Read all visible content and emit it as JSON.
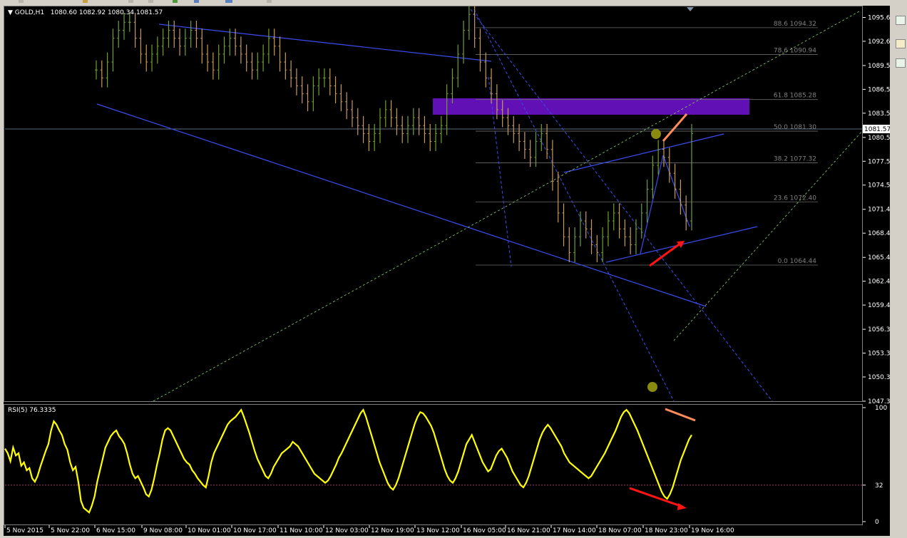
{
  "header": {
    "symbol": "GOLD,H1",
    "ohlc": "1080.60 1082.92 1080.34 1081.57",
    "rsi_label": "RSI(5) 76.3335"
  },
  "colors": {
    "background": "#000000",
    "bull_bar": "#6fa030",
    "bear_bar": "#c89a5a",
    "trendline": "#3b4cf0",
    "fib": "#6a6a6a",
    "zone": "#6a12c8",
    "rsi_line": "#ffff00",
    "arrow_red": "#ff1414",
    "arrow_orange": "#ff8c5a",
    "marker": "#8a8a10"
  },
  "current_price": "1081.57",
  "chart_data": [
    {
      "type": "line",
      "panel": "price",
      "title": "GOLD,H1",
      "ylim": [
        1047.31,
        1097.0
      ],
      "y_ticks": [
        "1095.61",
        "1092.61",
        "1089.56",
        "1086.56",
        "1083.56",
        "1080.51",
        "1077.51",
        "1074.51",
        "1071.46",
        "1068.46",
        "1065.41",
        "1062.41",
        "1059.41",
        "1056.36",
        "1053.36",
        "1050.36",
        "1047.31"
      ],
      "x_ticks": [
        "5 Nov 2015",
        "5 Nov 22:00",
        "6 Nov 15:00",
        "9 Nov 08:00",
        "10 Nov 01:00",
        "10 Nov 17:00",
        "11 Nov 10:00",
        "12 Nov 03:00",
        "12 Nov 19:00",
        "13 Nov 12:00",
        "16 Nov 05:00",
        "16 Nov 21:00",
        "17 Nov 14:00",
        "18 Nov 07:00",
        "18 Nov 23:00",
        "19 Nov 16:00"
      ],
      "fibonacci_levels": [
        {
          "ratio": "88.6",
          "price": "1094.32"
        },
        {
          "ratio": "78.6",
          "price": "1090.94"
        },
        {
          "ratio": "61.8",
          "price": "1085.28"
        },
        {
          "ratio": "50.0",
          "price": "1081.30"
        },
        {
          "ratio": "38.2",
          "price": "1077.32"
        },
        {
          "ratio": "23.6",
          "price": "1072.40"
        },
        {
          "ratio": "0.0",
          "price": "1064.44"
        }
      ],
      "close_series": [
        1089,
        1088,
        1090,
        1093,
        1094,
        1095,
        1095,
        1093,
        1091,
        1090,
        1091,
        1092,
        1093,
        1094,
        1093,
        1092,
        1093,
        1094,
        1093,
        1091,
        1090,
        1089,
        1091,
        1092,
        1093,
        1092,
        1091,
        1090,
        1089,
        1090,
        1091,
        1093,
        1092,
        1090,
        1089,
        1088,
        1087,
        1086,
        1085,
        1087,
        1088,
        1088,
        1087,
        1086,
        1085,
        1084,
        1083,
        1082,
        1081,
        1080,
        1081,
        1083,
        1084,
        1083,
        1082,
        1081,
        1082,
        1083,
        1082,
        1081,
        1080,
        1081,
        1082,
        1086,
        1088,
        1091,
        1094,
        1096,
        1093,
        1090,
        1088,
        1086,
        1084,
        1083,
        1082,
        1081,
        1080,
        1079,
        1078,
        1080,
        1081,
        1079,
        1075,
        1071,
        1068,
        1066,
        1068,
        1070,
        1069,
        1067,
        1066,
        1068,
        1070,
        1071,
        1069,
        1068,
        1067,
        1069,
        1071,
        1074,
        1077,
        1079,
        1078,
        1076,
        1074,
        1072,
        1070,
        1081
      ]
    },
    {
      "type": "line",
      "panel": "rsi",
      "title": "RSI(5) 76.3335",
      "ylim": [
        0,
        100
      ],
      "y_ticks": [
        "100",
        "32",
        "0"
      ],
      "levels": [
        32
      ],
      "series": [
        {
          "values": [
            64,
            60,
            53,
            65,
            58,
            60,
            49,
            52,
            45,
            47,
            38,
            35,
            40,
            48,
            55,
            62,
            68,
            80,
            88,
            85,
            80,
            76,
            68,
            63,
            52,
            45,
            48,
            35,
            18,
            12,
            10,
            8,
            14,
            22,
            35,
            45,
            55,
            65,
            70,
            75,
            78,
            80,
            75,
            72,
            68,
            60,
            50,
            42,
            38,
            40,
            35,
            30,
            24,
            22,
            28,
            38,
            50,
            60,
            72,
            80,
            82,
            80,
            75,
            70,
            65,
            60,
            55,
            52,
            50,
            45,
            42,
            38,
            35,
            32,
            30,
            40,
            52,
            60,
            65,
            70,
            75,
            80,
            85,
            88,
            90,
            92,
            95,
            98,
            92,
            85,
            78,
            70,
            62,
            55,
            50,
            45,
            40,
            38,
            42,
            48,
            52,
            56,
            60,
            62,
            64,
            66,
            70,
            68,
            66,
            62,
            58,
            54,
            50,
            46,
            42,
            40,
            38,
            36,
            34,
            36,
            40,
            45,
            50,
            56,
            60,
            65,
            70,
            75,
            80,
            85,
            90,
            95,
            98,
            92,
            84,
            76,
            68,
            60,
            52,
            46,
            40,
            34,
            30,
            28,
            32,
            38,
            46,
            54,
            62,
            70,
            78,
            86,
            92,
            96,
            95,
            92,
            88,
            84,
            78,
            70,
            62,
            54,
            46,
            40,
            36,
            34,
            38,
            44,
            52,
            60,
            68,
            72,
            76,
            70,
            64,
            58,
            52,
            48,
            44,
            46,
            52,
            58,
            62,
            64,
            60,
            56,
            50,
            44,
            40,
            36,
            32,
            30,
            34,
            40,
            48,
            56,
            64,
            72,
            78,
            82,
            85,
            82,
            78,
            74,
            70,
            66,
            60,
            56,
            52,
            50,
            48,
            46,
            44,
            42,
            40,
            38,
            40,
            44,
            48,
            52,
            56,
            60,
            65,
            70,
            75,
            80,
            86,
            92,
            96,
            98,
            95,
            90,
            85,
            80,
            74,
            68,
            62,
            56,
            50,
            44,
            38,
            32,
            26,
            22,
            20,
            24,
            30,
            38,
            46,
            54,
            60,
            66,
            72,
            76
          ]
        }
      ]
    }
  ]
}
